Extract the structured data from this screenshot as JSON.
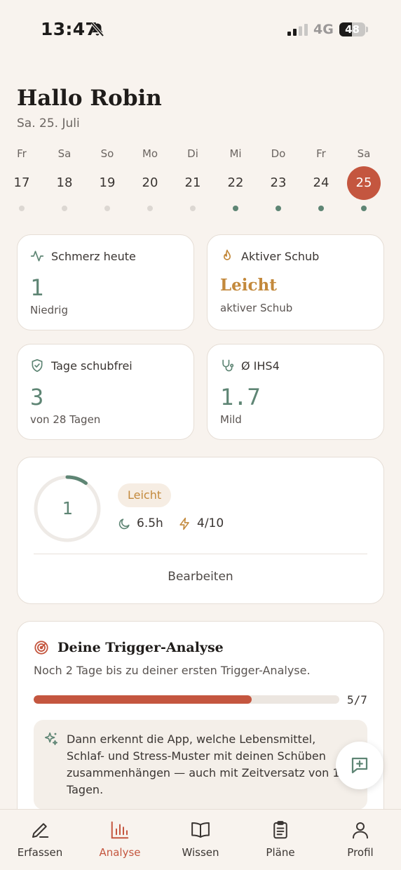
{
  "status_bar": {
    "time": "13:47",
    "network": "4G",
    "battery": "48",
    "battery_level": 0.48
  },
  "header": {
    "greeting": "Hallo Robin",
    "date": "Sa. 25. Juli"
  },
  "week": [
    {
      "name": "Fr",
      "num": "17",
      "logged": false,
      "active": false
    },
    {
      "name": "Sa",
      "num": "18",
      "logged": false,
      "active": false
    },
    {
      "name": "So",
      "num": "19",
      "logged": false,
      "active": false
    },
    {
      "name": "Mo",
      "num": "20",
      "logged": false,
      "active": false
    },
    {
      "name": "Di",
      "num": "21",
      "logged": false,
      "active": false
    },
    {
      "name": "Mi",
      "num": "22",
      "logged": true,
      "active": false
    },
    {
      "name": "Do",
      "num": "23",
      "logged": true,
      "active": false
    },
    {
      "name": "Fr",
      "num": "24",
      "logged": true,
      "active": false
    },
    {
      "name": "Sa",
      "num": "25",
      "logged": true,
      "active": true
    }
  ],
  "cards": {
    "pain": {
      "title": "Schmerz heute",
      "value": "1",
      "sub": "Niedrig"
    },
    "flare": {
      "title": "Aktiver Schub",
      "value": "Leicht",
      "sub": "aktiver Schub"
    },
    "free": {
      "title": "Tage schubfrei",
      "value": "3",
      "sub": "von 28 Tagen"
    },
    "ihs4": {
      "title": "Ø IHS4",
      "value": "1.7",
      "sub": "Mild"
    }
  },
  "daily": {
    "pain_value": "1",
    "pain_fraction": 0.1,
    "severity": "Leicht",
    "sleep": "6.5h",
    "stress": "4/10",
    "edit_label": "Bearbeiten"
  },
  "trigger": {
    "title": "Deine Trigger-Analyse",
    "subtitle": "Noch 2 Tage bis zu deiner ersten Trigger-Analyse.",
    "progress_label": "5/7",
    "progress": 0.714,
    "info": "Dann erkennt die App, welche Lebensmittel, Schlaf- und Stress-Muster mit deinen Schüben zusammenhängen — auch mit Zeitversatz von 1–3 Tagen."
  },
  "tabs": [
    {
      "label": "Erfassen",
      "icon": "pencil-icon",
      "active": false
    },
    {
      "label": "Analyse",
      "icon": "bar-chart-icon",
      "active": true
    },
    {
      "label": "Wissen",
      "icon": "book-icon",
      "active": false
    },
    {
      "label": "Pläne",
      "icon": "clipboard-icon",
      "active": false
    },
    {
      "label": "Profil",
      "icon": "user-icon",
      "active": false
    }
  ],
  "colors": {
    "accent": "#c4563f",
    "green": "#5e8574",
    "amber": "#c3893c",
    "background": "#f8f3ee"
  }
}
